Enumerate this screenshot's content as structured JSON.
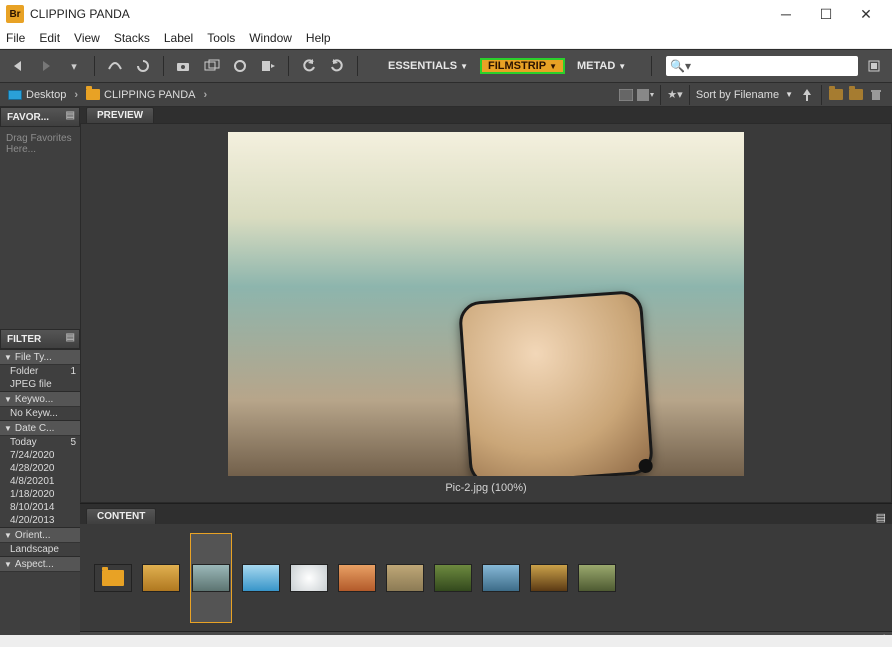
{
  "titlebar": {
    "app_badge": "Br",
    "title": "CLIPPING PANDA"
  },
  "menu": {
    "items": [
      "File",
      "Edit",
      "View",
      "Stacks",
      "Label",
      "Tools",
      "Window",
      "Help"
    ]
  },
  "workspaces": {
    "items": [
      "ESSENTIALS",
      "FILMSTRIP",
      "METAD"
    ],
    "active": 1
  },
  "search": {
    "placeholder": ""
  },
  "breadcrumb": {
    "items": [
      "Desktop",
      "CLIPPING PANDA"
    ]
  },
  "sort": {
    "label": "Sort by Filename"
  },
  "panels": {
    "favorites": {
      "tab": "FAVOR...",
      "hint": "Drag Favorites Here..."
    },
    "filter": {
      "tab": "FILTER",
      "sections": [
        {
          "title": "File Ty...",
          "rows": [
            {
              "label": "Folder",
              "count": "1"
            },
            {
              "label": "JPEG file",
              "count": ""
            }
          ]
        },
        {
          "title": "Keywo...",
          "rows": [
            {
              "label": "No Keyw...",
              "count": ""
            }
          ]
        },
        {
          "title": "Date C...",
          "rows": [
            {
              "label": "Today",
              "count": "5"
            },
            {
              "label": "7/24/2020",
              "count": ""
            },
            {
              "label": "4/28/2020",
              "count": ""
            },
            {
              "label": "4/8/20201",
              "count": ""
            },
            {
              "label": "1/18/2020",
              "count": ""
            },
            {
              "label": "8/10/2014",
              "count": ""
            },
            {
              "label": "4/20/2013",
              "count": ""
            }
          ]
        },
        {
          "title": "Orient...",
          "rows": [
            {
              "label": "Landscape",
              "count": ""
            }
          ]
        },
        {
          "title": "Aspect...",
          "rows": []
        }
      ]
    },
    "preview": {
      "tab": "PREVIEW",
      "caption": "Pic-2.jpg (100%)"
    },
    "content": {
      "tab": "CONTENT"
    }
  },
  "thumbs": {
    "items": [
      {
        "kind": "folder"
      },
      {
        "kind": "img",
        "bg": "linear-gradient(#e0b050,#b07820)"
      },
      {
        "kind": "img",
        "bg": "linear-gradient(#9bb8b9,#5c7471)",
        "selected": true
      },
      {
        "kind": "img",
        "bg": "linear-gradient(#a7d8ef,#3895c9)"
      },
      {
        "kind": "img",
        "bg": "radial-gradient(circle,#fff,#c9cfd2)"
      },
      {
        "kind": "img",
        "bg": "linear-gradient(#e8a064,#b35a2a)"
      },
      {
        "kind": "img",
        "bg": "linear-gradient(#bfa777,#8c7b55)"
      },
      {
        "kind": "img",
        "bg": "linear-gradient(#6d8a3f,#33491d)"
      },
      {
        "kind": "img",
        "bg": "linear-gradient(#86b8d6,#3d6c88)"
      },
      {
        "kind": "img",
        "bg": "linear-gradient(#caa149,#5c3a14)"
      },
      {
        "kind": "img",
        "bg": "linear-gradient(#9aa86d,#4e5a32)"
      }
    ]
  }
}
